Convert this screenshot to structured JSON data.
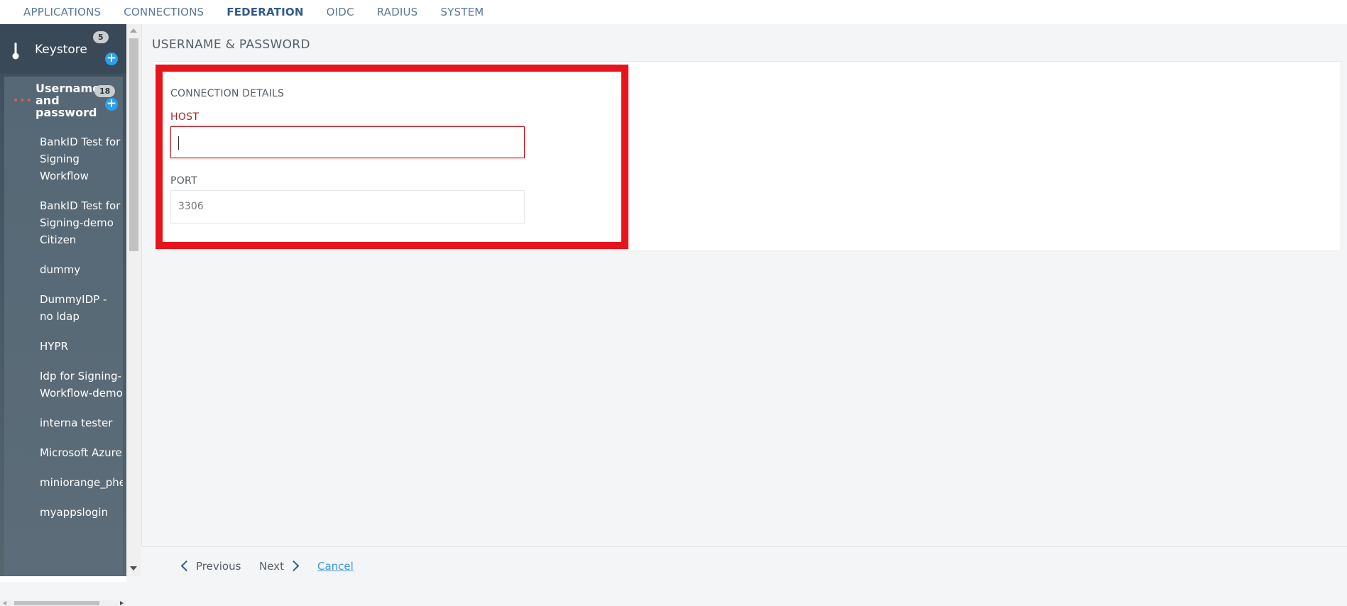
{
  "topnav": {
    "tabs": [
      {
        "label": "APPLICATIONS",
        "active": false
      },
      {
        "label": "CONNECTIONS",
        "active": false
      },
      {
        "label": "FEDERATION",
        "active": true
      },
      {
        "label": "OIDC",
        "active": false
      },
      {
        "label": "RADIUS",
        "active": false
      },
      {
        "label": "SYSTEM",
        "active": false
      }
    ]
  },
  "sidebar": {
    "keystore": {
      "label": "Keystore",
      "count": "5",
      "icon": "thermometer-icon",
      "add_icon": "plus-icon"
    },
    "group": {
      "label": "Username and password",
      "count": "18",
      "icon": "dots-icon",
      "add_icon": "plus-icon"
    },
    "items": [
      "BankID Test for Signing Workflow",
      "BankID Test for Signing-demo Citizen",
      "dummy",
      "DummyIDP - no ldap",
      "HYPR",
      "Idp for Signing-Workflow-demo",
      "interna tester",
      "Microsoft Azure",
      "miniorange_phen",
      "myappslogin"
    ]
  },
  "main": {
    "title": "USERNAME & PASSWORD",
    "section_title": "CONNECTION DETAILS",
    "host": {
      "label": "HOST",
      "value": ""
    },
    "port": {
      "label": "PORT",
      "value": "3306"
    }
  },
  "footer": {
    "previous_label": "Previous",
    "next_label": "Next",
    "cancel_label": "Cancel"
  },
  "colors": {
    "highlight": "#e8141c",
    "accent": "#2f5b8a",
    "link": "#3a9ad9"
  }
}
